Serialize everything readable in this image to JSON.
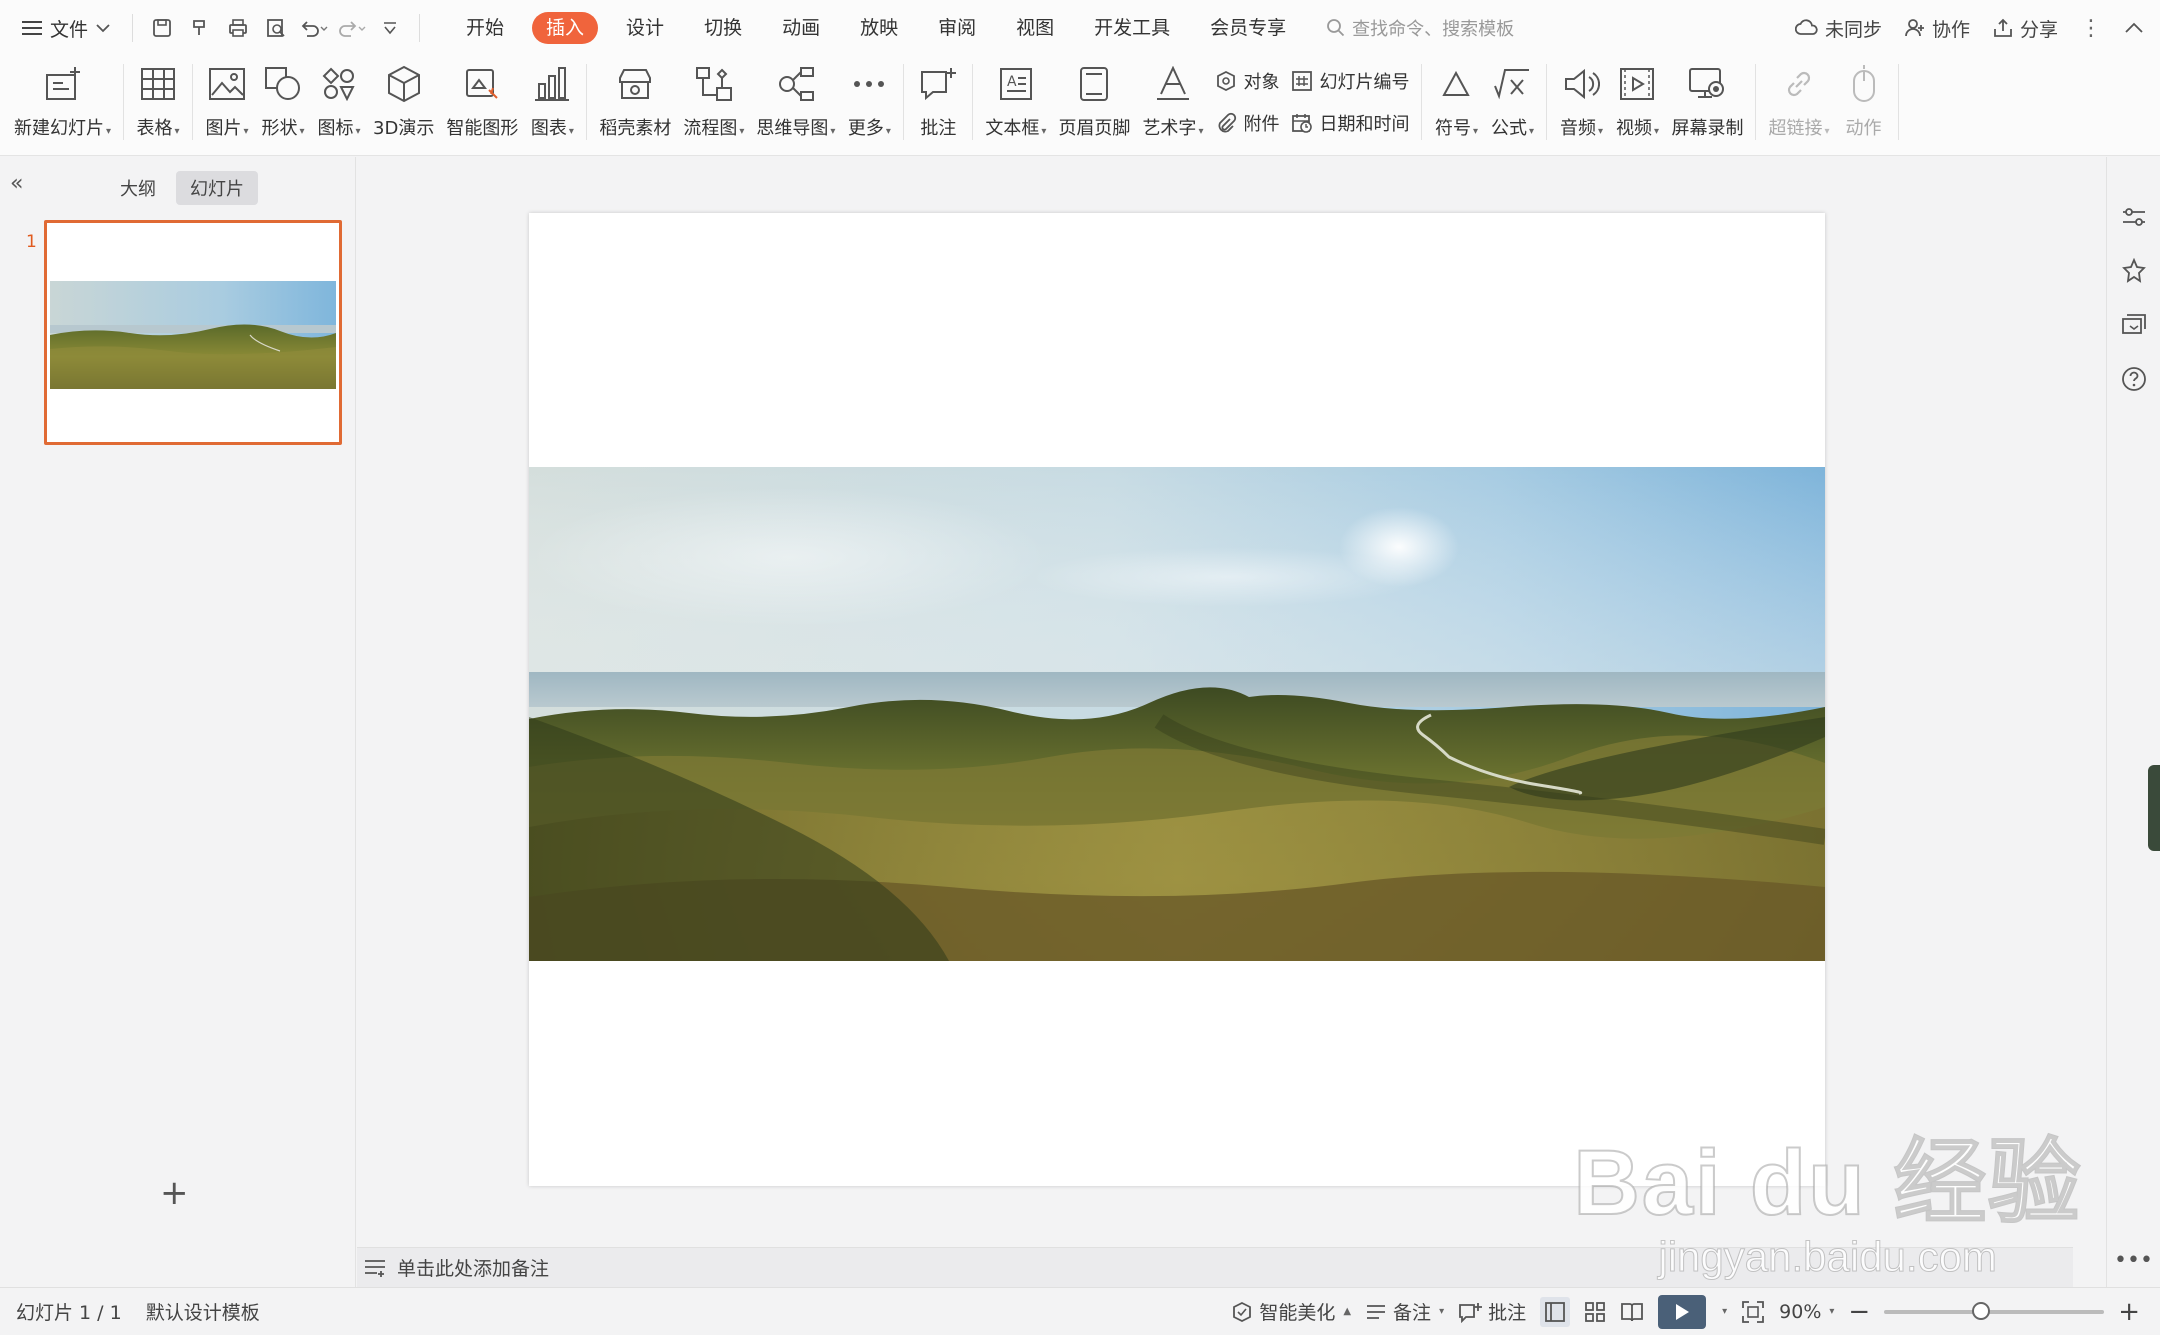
{
  "menubar": {
    "file_label": "文件",
    "tabs": [
      {
        "label": "开始"
      },
      {
        "label": "插入",
        "active": true
      },
      {
        "label": "设计"
      },
      {
        "label": "切换"
      },
      {
        "label": "动画"
      },
      {
        "label": "放映"
      },
      {
        "label": "审阅"
      },
      {
        "label": "视图"
      },
      {
        "label": "开发工具"
      },
      {
        "label": "会员专享"
      }
    ],
    "search_placeholder": "查找命令、搜索模板",
    "sync_label": "未同步",
    "collab_label": "协作",
    "share_label": "分享",
    "active_tab_color": "#f0643c"
  },
  "ribbon": {
    "new_slide": "新建幻灯片",
    "table": "表格",
    "picture": "图片",
    "shape": "形状",
    "icon": "图标",
    "demo3d": "3D演示",
    "smartart": "智能图形",
    "chart": "图表",
    "material": "稻壳素材",
    "flowchart": "流程图",
    "mindmap": "思维导图",
    "more": "更多",
    "comment": "批注",
    "textbox": "文本框",
    "header_footer": "页眉页脚",
    "wordart": "艺术字",
    "object": "对象",
    "slide_number": "幻灯片编号",
    "attachment": "附件",
    "datetime": "日期和时间",
    "symbol": "符号",
    "formula": "公式",
    "audio": "音频",
    "video": "视频",
    "screen_record": "屏幕录制",
    "hyperlink": "超链接",
    "action": "动作"
  },
  "left_panel": {
    "tab_outline": "大纲",
    "tab_slides": "幻灯片",
    "slide_numbers": [
      "1"
    ],
    "selected_border_color": "#e06a34"
  },
  "notes": {
    "placeholder": "单击此处添加备注"
  },
  "status": {
    "slide_counter": "幻灯片 1 / 1",
    "template": "默认设计模板",
    "beautify": "智能美化",
    "notes": "备注",
    "comments": "批注",
    "zoom": "90%"
  },
  "watermark": {
    "logo_text": "Bai du 经验",
    "url": "jingyan.baidu.com"
  }
}
